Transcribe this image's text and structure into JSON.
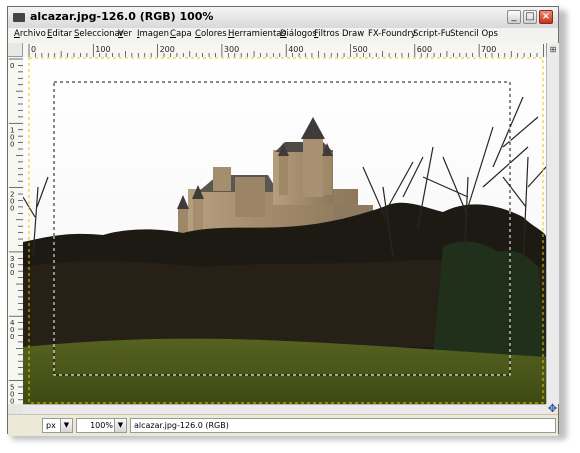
{
  "window": {
    "title": "alcazar.jpg-126.0 (RGB) 100%",
    "controls": {
      "minimize": "_",
      "maximize": "□",
      "close": "×"
    }
  },
  "menubar": {
    "items": [
      {
        "pre": "",
        "u": "A",
        "post": "rchivo"
      },
      {
        "pre": "",
        "u": "E",
        "post": "ditar"
      },
      {
        "pre": "",
        "u": "S",
        "post": "eleccionar"
      },
      {
        "pre": "",
        "u": "V",
        "post": "er"
      },
      {
        "pre": "",
        "u": "I",
        "post": "magen"
      },
      {
        "pre": "",
        "u": "C",
        "post": "apa"
      },
      {
        "pre": "",
        "u": "C",
        "post": "olores"
      },
      {
        "pre": "",
        "u": "H",
        "post": "erramientas"
      },
      {
        "pre": "",
        "u": "D",
        "post": "iálogos"
      },
      {
        "pre": "",
        "u": "F",
        "post": "iltros"
      },
      {
        "pre": "",
        "u": "",
        "post": "Draw"
      },
      {
        "pre": "",
        "u": "",
        "post": "FX-Foundry"
      },
      {
        "pre": "",
        "u": "",
        "post": "Script-Fu"
      },
      {
        "pre": "",
        "u": "",
        "post": "Stencil Ops"
      }
    ]
  },
  "rulers": {
    "horizontal": [
      "0",
      "100",
      "200",
      "300",
      "400",
      "500",
      "600",
      "700"
    ],
    "vertical": [
      "0",
      "100",
      "200",
      "300",
      "400",
      "500"
    ]
  },
  "statusbar": {
    "unit": "px",
    "zoom": "100%",
    "message": "alcazar.jpg-126.0 (RGB)"
  },
  "icons": {
    "navigate": "navigate-icon",
    "quickmask": "quickmask-icon"
  }
}
